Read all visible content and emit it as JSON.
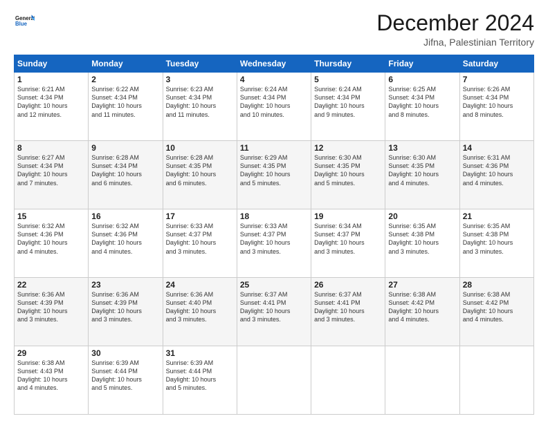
{
  "logo": {
    "line1": "General",
    "line2": "Blue"
  },
  "header": {
    "month_title": "December 2024",
    "subtitle": "Jifna, Palestinian Territory"
  },
  "weekdays": [
    "Sunday",
    "Monday",
    "Tuesday",
    "Wednesday",
    "Thursday",
    "Friday",
    "Saturday"
  ],
  "weeks": [
    [
      {
        "day": "1",
        "info": "Sunrise: 6:21 AM\nSunset: 4:34 PM\nDaylight: 10 hours\nand 12 minutes."
      },
      {
        "day": "2",
        "info": "Sunrise: 6:22 AM\nSunset: 4:34 PM\nDaylight: 10 hours\nand 11 minutes."
      },
      {
        "day": "3",
        "info": "Sunrise: 6:23 AM\nSunset: 4:34 PM\nDaylight: 10 hours\nand 11 minutes."
      },
      {
        "day": "4",
        "info": "Sunrise: 6:24 AM\nSunset: 4:34 PM\nDaylight: 10 hours\nand 10 minutes."
      },
      {
        "day": "5",
        "info": "Sunrise: 6:24 AM\nSunset: 4:34 PM\nDaylight: 10 hours\nand 9 minutes."
      },
      {
        "day": "6",
        "info": "Sunrise: 6:25 AM\nSunset: 4:34 PM\nDaylight: 10 hours\nand 8 minutes."
      },
      {
        "day": "7",
        "info": "Sunrise: 6:26 AM\nSunset: 4:34 PM\nDaylight: 10 hours\nand 8 minutes."
      }
    ],
    [
      {
        "day": "8",
        "info": "Sunrise: 6:27 AM\nSunset: 4:34 PM\nDaylight: 10 hours\nand 7 minutes."
      },
      {
        "day": "9",
        "info": "Sunrise: 6:28 AM\nSunset: 4:34 PM\nDaylight: 10 hours\nand 6 minutes."
      },
      {
        "day": "10",
        "info": "Sunrise: 6:28 AM\nSunset: 4:35 PM\nDaylight: 10 hours\nand 6 minutes."
      },
      {
        "day": "11",
        "info": "Sunrise: 6:29 AM\nSunset: 4:35 PM\nDaylight: 10 hours\nand 5 minutes."
      },
      {
        "day": "12",
        "info": "Sunrise: 6:30 AM\nSunset: 4:35 PM\nDaylight: 10 hours\nand 5 minutes."
      },
      {
        "day": "13",
        "info": "Sunrise: 6:30 AM\nSunset: 4:35 PM\nDaylight: 10 hours\nand 4 minutes."
      },
      {
        "day": "14",
        "info": "Sunrise: 6:31 AM\nSunset: 4:36 PM\nDaylight: 10 hours\nand 4 minutes."
      }
    ],
    [
      {
        "day": "15",
        "info": "Sunrise: 6:32 AM\nSunset: 4:36 PM\nDaylight: 10 hours\nand 4 minutes."
      },
      {
        "day": "16",
        "info": "Sunrise: 6:32 AM\nSunset: 4:36 PM\nDaylight: 10 hours\nand 4 minutes."
      },
      {
        "day": "17",
        "info": "Sunrise: 6:33 AM\nSunset: 4:37 PM\nDaylight: 10 hours\nand 3 minutes."
      },
      {
        "day": "18",
        "info": "Sunrise: 6:33 AM\nSunset: 4:37 PM\nDaylight: 10 hours\nand 3 minutes."
      },
      {
        "day": "19",
        "info": "Sunrise: 6:34 AM\nSunset: 4:37 PM\nDaylight: 10 hours\nand 3 minutes."
      },
      {
        "day": "20",
        "info": "Sunrise: 6:35 AM\nSunset: 4:38 PM\nDaylight: 10 hours\nand 3 minutes."
      },
      {
        "day": "21",
        "info": "Sunrise: 6:35 AM\nSunset: 4:38 PM\nDaylight: 10 hours\nand 3 minutes."
      }
    ],
    [
      {
        "day": "22",
        "info": "Sunrise: 6:36 AM\nSunset: 4:39 PM\nDaylight: 10 hours\nand 3 minutes."
      },
      {
        "day": "23",
        "info": "Sunrise: 6:36 AM\nSunset: 4:39 PM\nDaylight: 10 hours\nand 3 minutes."
      },
      {
        "day": "24",
        "info": "Sunrise: 6:36 AM\nSunset: 4:40 PM\nDaylight: 10 hours\nand 3 minutes."
      },
      {
        "day": "25",
        "info": "Sunrise: 6:37 AM\nSunset: 4:41 PM\nDaylight: 10 hours\nand 3 minutes."
      },
      {
        "day": "26",
        "info": "Sunrise: 6:37 AM\nSunset: 4:41 PM\nDaylight: 10 hours\nand 3 minutes."
      },
      {
        "day": "27",
        "info": "Sunrise: 6:38 AM\nSunset: 4:42 PM\nDaylight: 10 hours\nand 4 minutes."
      },
      {
        "day": "28",
        "info": "Sunrise: 6:38 AM\nSunset: 4:42 PM\nDaylight: 10 hours\nand 4 minutes."
      }
    ],
    [
      {
        "day": "29",
        "info": "Sunrise: 6:38 AM\nSunset: 4:43 PM\nDaylight: 10 hours\nand 4 minutes."
      },
      {
        "day": "30",
        "info": "Sunrise: 6:39 AM\nSunset: 4:44 PM\nDaylight: 10 hours\nand 5 minutes."
      },
      {
        "day": "31",
        "info": "Sunrise: 6:39 AM\nSunset: 4:44 PM\nDaylight: 10 hours\nand 5 minutes."
      },
      null,
      null,
      null,
      null
    ]
  ]
}
